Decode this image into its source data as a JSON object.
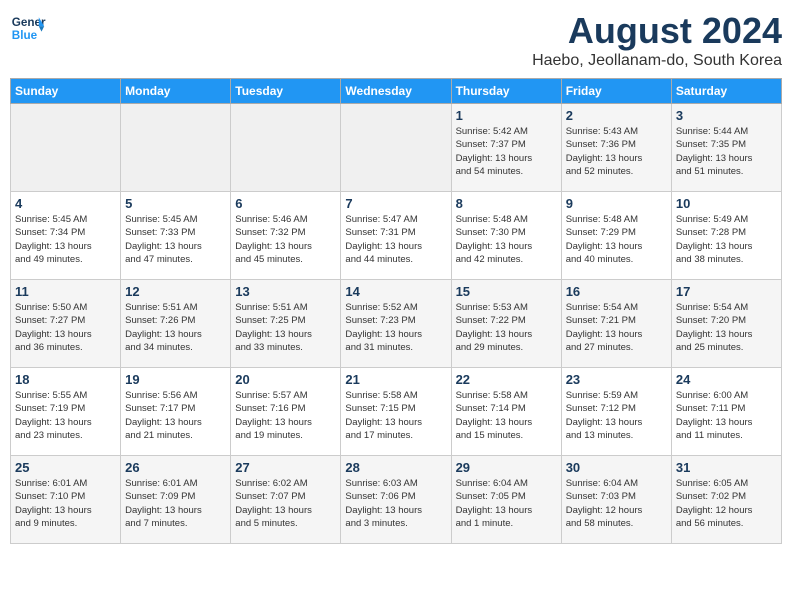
{
  "logo": {
    "line1": "General",
    "line2": "Blue"
  },
  "title": "August 2024",
  "subtitle": "Haebo, Jeollanam-do, South Korea",
  "weekdays": [
    "Sunday",
    "Monday",
    "Tuesday",
    "Wednesday",
    "Thursday",
    "Friday",
    "Saturday"
  ],
  "weeks": [
    [
      {
        "day": "",
        "info": ""
      },
      {
        "day": "",
        "info": ""
      },
      {
        "day": "",
        "info": ""
      },
      {
        "day": "",
        "info": ""
      },
      {
        "day": "1",
        "info": "Sunrise: 5:42 AM\nSunset: 7:37 PM\nDaylight: 13 hours\nand 54 minutes."
      },
      {
        "day": "2",
        "info": "Sunrise: 5:43 AM\nSunset: 7:36 PM\nDaylight: 13 hours\nand 52 minutes."
      },
      {
        "day": "3",
        "info": "Sunrise: 5:44 AM\nSunset: 7:35 PM\nDaylight: 13 hours\nand 51 minutes."
      }
    ],
    [
      {
        "day": "4",
        "info": "Sunrise: 5:45 AM\nSunset: 7:34 PM\nDaylight: 13 hours\nand 49 minutes."
      },
      {
        "day": "5",
        "info": "Sunrise: 5:45 AM\nSunset: 7:33 PM\nDaylight: 13 hours\nand 47 minutes."
      },
      {
        "day": "6",
        "info": "Sunrise: 5:46 AM\nSunset: 7:32 PM\nDaylight: 13 hours\nand 45 minutes."
      },
      {
        "day": "7",
        "info": "Sunrise: 5:47 AM\nSunset: 7:31 PM\nDaylight: 13 hours\nand 44 minutes."
      },
      {
        "day": "8",
        "info": "Sunrise: 5:48 AM\nSunset: 7:30 PM\nDaylight: 13 hours\nand 42 minutes."
      },
      {
        "day": "9",
        "info": "Sunrise: 5:48 AM\nSunset: 7:29 PM\nDaylight: 13 hours\nand 40 minutes."
      },
      {
        "day": "10",
        "info": "Sunrise: 5:49 AM\nSunset: 7:28 PM\nDaylight: 13 hours\nand 38 minutes."
      }
    ],
    [
      {
        "day": "11",
        "info": "Sunrise: 5:50 AM\nSunset: 7:27 PM\nDaylight: 13 hours\nand 36 minutes."
      },
      {
        "day": "12",
        "info": "Sunrise: 5:51 AM\nSunset: 7:26 PM\nDaylight: 13 hours\nand 34 minutes."
      },
      {
        "day": "13",
        "info": "Sunrise: 5:51 AM\nSunset: 7:25 PM\nDaylight: 13 hours\nand 33 minutes."
      },
      {
        "day": "14",
        "info": "Sunrise: 5:52 AM\nSunset: 7:23 PM\nDaylight: 13 hours\nand 31 minutes."
      },
      {
        "day": "15",
        "info": "Sunrise: 5:53 AM\nSunset: 7:22 PM\nDaylight: 13 hours\nand 29 minutes."
      },
      {
        "day": "16",
        "info": "Sunrise: 5:54 AM\nSunset: 7:21 PM\nDaylight: 13 hours\nand 27 minutes."
      },
      {
        "day": "17",
        "info": "Sunrise: 5:54 AM\nSunset: 7:20 PM\nDaylight: 13 hours\nand 25 minutes."
      }
    ],
    [
      {
        "day": "18",
        "info": "Sunrise: 5:55 AM\nSunset: 7:19 PM\nDaylight: 13 hours\nand 23 minutes."
      },
      {
        "day": "19",
        "info": "Sunrise: 5:56 AM\nSunset: 7:17 PM\nDaylight: 13 hours\nand 21 minutes."
      },
      {
        "day": "20",
        "info": "Sunrise: 5:57 AM\nSunset: 7:16 PM\nDaylight: 13 hours\nand 19 minutes."
      },
      {
        "day": "21",
        "info": "Sunrise: 5:58 AM\nSunset: 7:15 PM\nDaylight: 13 hours\nand 17 minutes."
      },
      {
        "day": "22",
        "info": "Sunrise: 5:58 AM\nSunset: 7:14 PM\nDaylight: 13 hours\nand 15 minutes."
      },
      {
        "day": "23",
        "info": "Sunrise: 5:59 AM\nSunset: 7:12 PM\nDaylight: 13 hours\nand 13 minutes."
      },
      {
        "day": "24",
        "info": "Sunrise: 6:00 AM\nSunset: 7:11 PM\nDaylight: 13 hours\nand 11 minutes."
      }
    ],
    [
      {
        "day": "25",
        "info": "Sunrise: 6:01 AM\nSunset: 7:10 PM\nDaylight: 13 hours\nand 9 minutes."
      },
      {
        "day": "26",
        "info": "Sunrise: 6:01 AM\nSunset: 7:09 PM\nDaylight: 13 hours\nand 7 minutes."
      },
      {
        "day": "27",
        "info": "Sunrise: 6:02 AM\nSunset: 7:07 PM\nDaylight: 13 hours\nand 5 minutes."
      },
      {
        "day": "28",
        "info": "Sunrise: 6:03 AM\nSunset: 7:06 PM\nDaylight: 13 hours\nand 3 minutes."
      },
      {
        "day": "29",
        "info": "Sunrise: 6:04 AM\nSunset: 7:05 PM\nDaylight: 13 hours\nand 1 minute."
      },
      {
        "day": "30",
        "info": "Sunrise: 6:04 AM\nSunset: 7:03 PM\nDaylight: 12 hours\nand 58 minutes."
      },
      {
        "day": "31",
        "info": "Sunrise: 6:05 AM\nSunset: 7:02 PM\nDaylight: 12 hours\nand 56 minutes."
      }
    ]
  ]
}
